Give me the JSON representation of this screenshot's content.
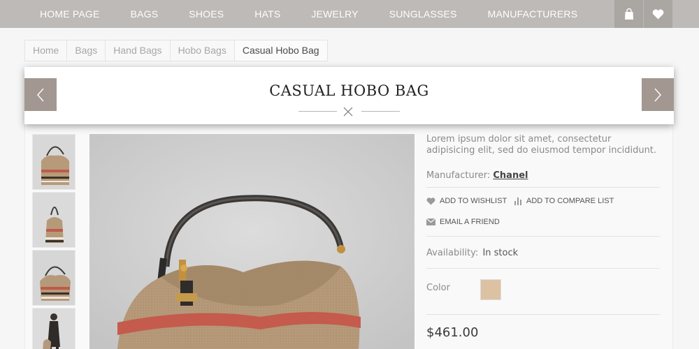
{
  "nav": {
    "items": [
      "HOME PAGE",
      "BAGS",
      "SHOES",
      "HATS",
      "JEWELRY",
      "SUNGLASSES",
      "MANUFACTURERS"
    ],
    "cart_icon": "shopping-bag-icon",
    "wishlist_icon": "heart-icon"
  },
  "breadcrumb": [
    "Home",
    "Bags",
    "Hand Bags",
    "Hobo Bags",
    "Casual Hobo Bag"
  ],
  "product": {
    "title": "CASUAL HOBO BAG",
    "description": "Lorem ipsum dolor sit amet, consectetur adipisicing elit, sed do eiusmod tempor incididunt.",
    "manufacturer_label": "Manufacturer:",
    "manufacturer": "Chanel",
    "actions": {
      "wishlist": "ADD TO WISHLIST",
      "compare": "ADD TO COMPARE LIST",
      "email": "EMAIL A FRIEND"
    },
    "availability_label": "Availability:",
    "availability": "In stock",
    "color_label": "Color",
    "color_swatch": "#dcc1a3",
    "price": "$461.00"
  },
  "colors": {
    "nav_bg": "#bdbab7",
    "arrow_bg": "#a29891"
  }
}
